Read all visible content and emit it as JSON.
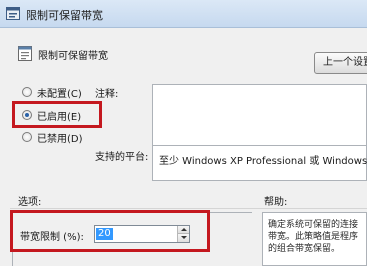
{
  "window": {
    "title": "限制可保留带宽"
  },
  "header": {
    "policy_name": "限制可保留带宽",
    "prev_button_label": "上一个设置"
  },
  "state_options": [
    {
      "label": "未配置(C)",
      "selected": false
    },
    {
      "label": "已启用(E)",
      "selected": true
    },
    {
      "label": "已禁用(D)",
      "selected": false
    }
  ],
  "comment": {
    "label": "注释:",
    "value": ""
  },
  "platform": {
    "label": "支持的平台:",
    "value": "至少 Windows XP Professional 或 Windows Se"
  },
  "options": {
    "label": "选项:",
    "bandwidth_label": "带宽限制 (%):",
    "bandwidth_value": "20"
  },
  "help": {
    "label": "帮助:",
    "text": "确定系统可保留的连接带宽。此策略值是程序的组合带宽保留。"
  },
  "colors": {
    "highlight_box": "#c4181f",
    "selection": "#3399ff"
  }
}
